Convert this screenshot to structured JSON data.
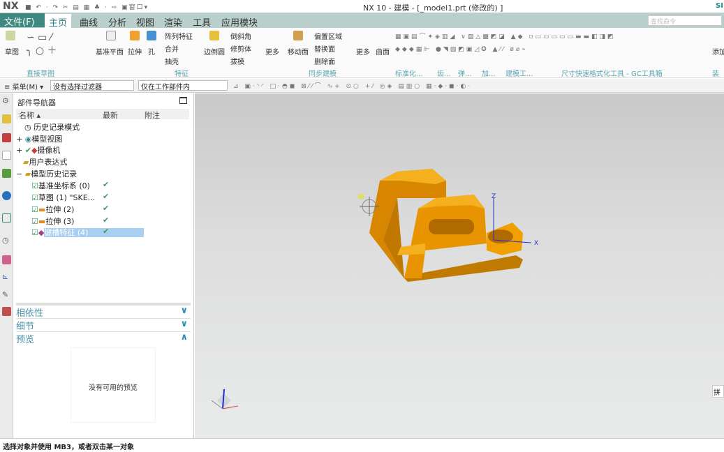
{
  "app": {
    "logo": "NX",
    "title": "NX 10 - 建模 - [_model1.prt  (修改的) ]",
    "brand": "SI",
    "window_menu": "窗口"
  },
  "tabs": [
    {
      "label": "文件(F)"
    },
    {
      "label": "主页"
    },
    {
      "label": "曲线"
    },
    {
      "label": "分析"
    },
    {
      "label": "视图"
    },
    {
      "label": "渲染"
    },
    {
      "label": "工具"
    },
    {
      "label": "应用模块"
    }
  ],
  "search": {
    "placeholder": "查找命令"
  },
  "ribbon": {
    "sketch": "草图",
    "datum_plane": "基准平面",
    "extrude": "拉伸",
    "hole": "孔",
    "pattern": "阵列特征",
    "unite": "合并",
    "shell": "抽壳",
    "edge_blend": "边倒圆",
    "chamfer": "倒斜角",
    "trim_body": "修剪体",
    "draft": "拔模",
    "more1": "更多",
    "move_face": "移动面",
    "offset_region": "偏置区域",
    "replace_face": "替换面",
    "delete_face": "删除面",
    "more2": "更多",
    "surface": "曲面",
    "add": "添加",
    "groups": {
      "direct_sketch": "直接草图",
      "feature": "特征",
      "sync": "同步建模",
      "standard": "标准化...",
      "g1": "齿...",
      "g2": "弹...",
      "g3": "加...",
      "modeling_tools": "建模工...",
      "gc": "尺寸快速格式化工具 - GC工具箱",
      "assembly": "装配"
    }
  },
  "toolbar": {
    "menu": "菜单(M)",
    "filter": "没有选择过滤器",
    "scope": "仅在工作部件内"
  },
  "navigator": {
    "title": "部件导航器",
    "columns": [
      "名称",
      "最新",
      "附注"
    ],
    "items": [
      {
        "label": "历史记录模式",
        "latest": ""
      },
      {
        "label": "模型视图",
        "latest": ""
      },
      {
        "label": "摄像机",
        "latest": ""
      },
      {
        "label": "用户表达式",
        "latest": ""
      },
      {
        "label": "模型历史记录",
        "latest": ""
      },
      {
        "label": "基准坐标系 (0)",
        "latest": "✔"
      },
      {
        "label": "草图 (1) \"SKE...",
        "latest": "✔"
      },
      {
        "label": "拉伸 (2)",
        "latest": "✔"
      },
      {
        "label": "拉伸 (3)",
        "latest": "✔"
      },
      {
        "label": "键槽特征 (4)",
        "latest": "✔",
        "selected": true
      }
    ],
    "sections": [
      {
        "label": "相依性",
        "expanded": false
      },
      {
        "label": "细节",
        "expanded": false
      },
      {
        "label": "预览",
        "expanded": true
      }
    ],
    "preview_empty": "没有可用的预览"
  },
  "viewport": {
    "axis_x": "X",
    "axis_z": "Z",
    "model_color": "#f0a000",
    "edge_button": "拼"
  },
  "status": {
    "text": "选择对象并使用 MB3，或者双击某一对象"
  }
}
